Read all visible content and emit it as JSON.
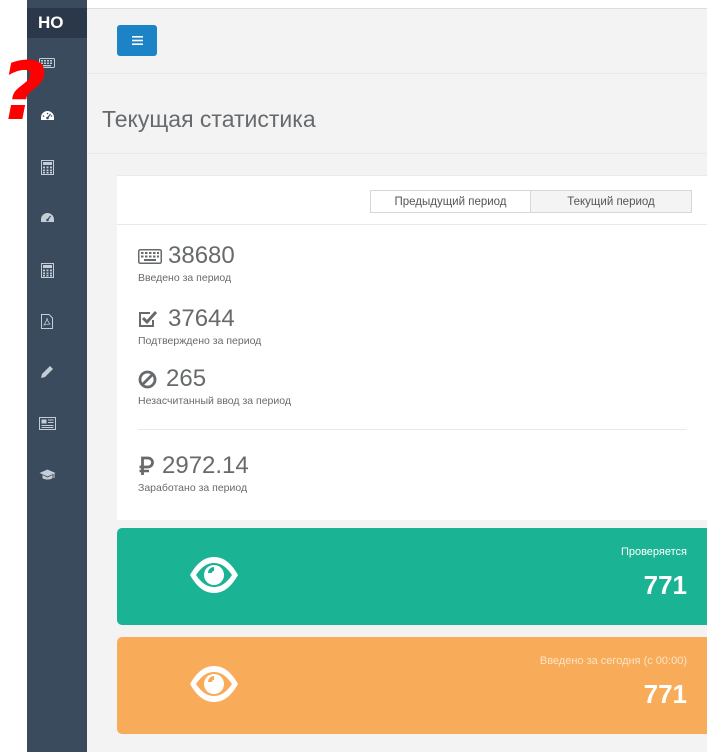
{
  "sidebar": {
    "brand": "НО",
    "items": [
      {
        "icon": "keyboard-icon"
      },
      {
        "icon": "dashboard-icon"
      },
      {
        "icon": "calculator-icon"
      },
      {
        "icon": "dashboard-icon"
      },
      {
        "icon": "calculator-icon"
      },
      {
        "icon": "pdf-file-icon"
      },
      {
        "icon": "pencil-icon"
      },
      {
        "icon": "newspaper-icon"
      },
      {
        "icon": "graduation-cap-icon"
      }
    ]
  },
  "overlay": {
    "mark": "?"
  },
  "header": {
    "menu_icon": "hamburger-icon"
  },
  "page": {
    "title": "Текущая статистика"
  },
  "period_toggle": {
    "options": [
      "Предыдущий период",
      "Текущий период"
    ],
    "selected": "Текущий период"
  },
  "stats": {
    "entered": {
      "value": "38680",
      "label": "Введено за период",
      "icon": "keyboard-icon"
    },
    "confirmed": {
      "value": "37644",
      "label": "Подтверждено за период",
      "icon": "check-square-icon"
    },
    "rejected": {
      "value": "265",
      "label": "Незасчитанный ввод за период",
      "icon": "ban-icon"
    },
    "earned": {
      "value": "2972.14",
      "label": "Заработано за период",
      "icon": "ruble-icon"
    }
  },
  "widgets": {
    "checking": {
      "label": "Проверяется",
      "value": "771",
      "color": "#1ab394",
      "icon": "eye-icon"
    },
    "today": {
      "label": "Введено за сегодня (с 00:00)",
      "value": "771",
      "color": "#f8ac59",
      "icon": "eye-icon"
    }
  },
  "colors": {
    "sidebar": "#3b4b5e",
    "brand_bg": "#2b3849",
    "menu_button": "#1c84c6",
    "question_mark": "#ff0000"
  }
}
